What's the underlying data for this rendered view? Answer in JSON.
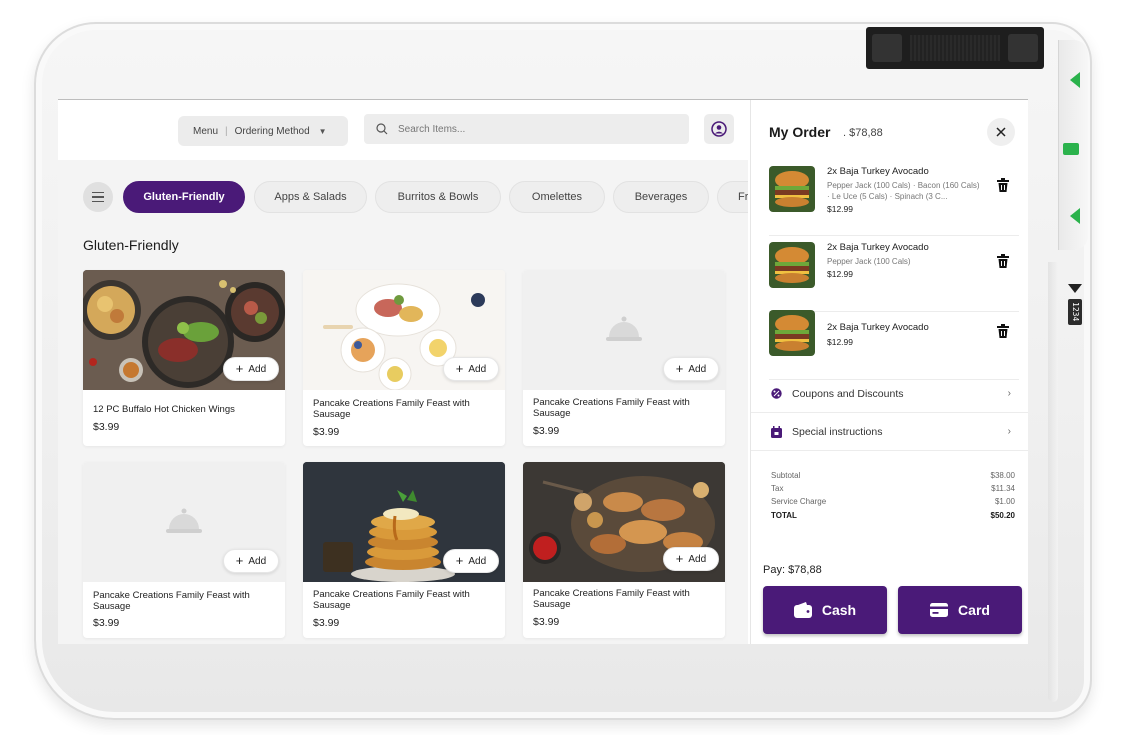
{
  "header": {
    "menu_label": "Menu",
    "ordering_method_label": "Ordering Method",
    "search_placeholder": "Search Items..."
  },
  "categories": [
    {
      "label": "Gluten-Friendly",
      "active": true
    },
    {
      "label": "Apps & Salads",
      "active": false
    },
    {
      "label": "Burritos & Bowls",
      "active": false
    },
    {
      "label": "Omelettes",
      "active": false
    },
    {
      "label": "Beverages",
      "active": false
    },
    {
      "label": "Fr",
      "active": false
    }
  ],
  "section_title": "Gluten-Friendly",
  "add_label": "Add",
  "products": [
    {
      "name": "12 PC Buffalo Hot Chicken Wings",
      "price": "$3.99",
      "image": "salad-plates-photo"
    },
    {
      "name": "Pancake Creations Family Feast with Sausage",
      "price": "$3.99",
      "image": "brunch-table-photo"
    },
    {
      "name": "Pancake Creations Family Feast with Sausage",
      "price": "$3.99",
      "image": "placeholder-cloche-icon"
    },
    {
      "name": "Pancake Creations Family Feast with Sausage",
      "price": "$3.99",
      "image": "placeholder-cloche-icon"
    },
    {
      "name": "Pancake Creations Family Feast with Sausage",
      "price": "$3.99",
      "image": "pancake-stack-photo"
    },
    {
      "name": "Pancake Creations Family Feast with Sausage",
      "price": "$3.99",
      "image": "grilled-skewers-photo"
    }
  ],
  "order": {
    "title": "My Order",
    "total_display": ". $78,88",
    "items": [
      {
        "name": "2x Baja  Turkey Avocado",
        "modifiers": "Pepper Jack (100 Cals) · Bacon (160 Cals) · Le Uce (5 Cals) · Spinach (3 C...",
        "price": "$12.99"
      },
      {
        "name": "2x Baja  Turkey Avocado",
        "modifiers": "Pepper Jack (100 Cals)",
        "price": "$12.99"
      },
      {
        "name": "2x Baja  Turkey Avocado",
        "modifiers": "",
        "price": "$12.99"
      }
    ],
    "coupons_label": "Coupons and Discounts",
    "special_label": "Special instructions",
    "totals": [
      {
        "label": "Subtotal",
        "value": "$38.00"
      },
      {
        "label": "Tax",
        "value": "$11.34"
      },
      {
        "label": "Service Charge",
        "value": "$1.00"
      },
      {
        "label": "TOTAL",
        "value": "$50.20"
      }
    ],
    "pay_label": "Pay: $78,88",
    "cash_label": "Cash",
    "card_label": "Card"
  },
  "device": {
    "side_tag": "1234"
  },
  "colors": {
    "accent": "#4a1a78",
    "side_led": "#2bb24c"
  }
}
